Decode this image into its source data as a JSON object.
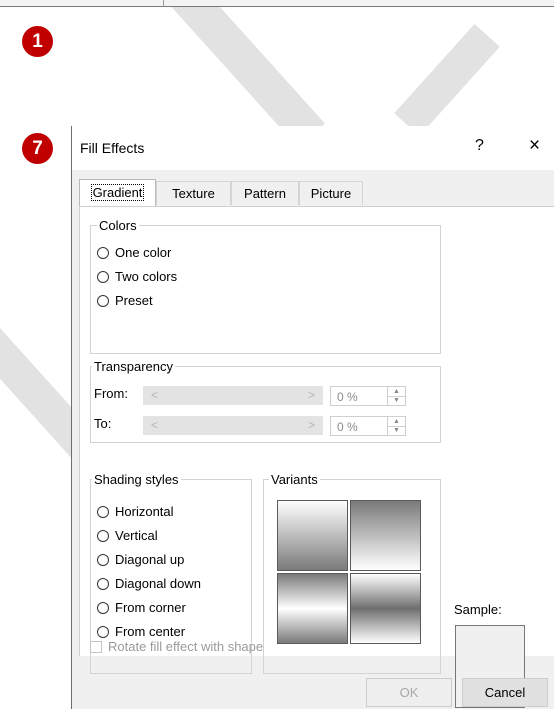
{
  "steps": [
    "1",
    "7"
  ],
  "dialog": {
    "title": "Fill Effects",
    "help_glyph": "?",
    "close_glyph": "×",
    "tabs": [
      "Gradient",
      "Texture",
      "Pattern",
      "Picture"
    ],
    "active_tab": "Gradient",
    "colors": {
      "label": "Colors",
      "options": [
        "One color",
        "Two colors",
        "Preset"
      ]
    },
    "transparency": {
      "label": "Transparency",
      "from_label": "From:",
      "to_label": "To:",
      "from_value": "0 %",
      "to_value": "0 %",
      "slider_left": "<",
      "slider_right": ">"
    },
    "shading": {
      "label": "Shading styles",
      "options": [
        "Horizontal",
        "Vertical",
        "Diagonal up",
        "Diagonal down",
        "From corner",
        "From center"
      ]
    },
    "variants_label": "Variants",
    "sample_label": "Sample:",
    "rotate_label": "Rotate fill effect with shape",
    "ok_label": "OK",
    "cancel_label": "Cancel"
  }
}
